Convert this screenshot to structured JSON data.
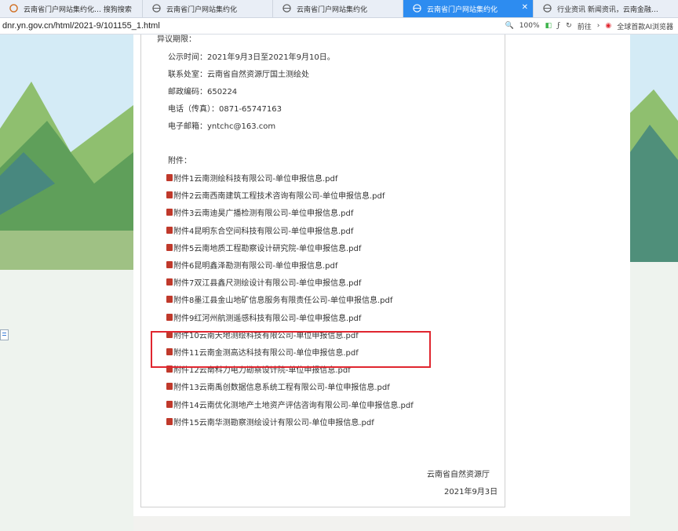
{
  "tabs": [
    {
      "label": "云南省门户网站集约化…  搜狗搜索",
      "active": false
    },
    {
      "label": "云南省门户网站集约化",
      "active": false
    },
    {
      "label": "云南省门户网站集约化",
      "active": false
    },
    {
      "label": "云南省门户网站集约化",
      "active": true
    },
    {
      "label": "行业资讯   新闻资讯，云南金融…",
      "active": false
    }
  ],
  "address_bar": {
    "url": "dnr.yn.gov.cn/html/2021-9/101155_1.html",
    "zoom": "100%",
    "extra_label": "前往",
    "right_label": "全球首款AI浏览器"
  },
  "document": {
    "intro_line": "异议期限：",
    "notice_period": "公示时间：2021年9月3日至2021年9月10日。",
    "contact_unit": "联系处室：云南省自然资源厅国土测绘处",
    "postcode": "邮政编码：650224",
    "phone": "电话（传真）：0871-65747163",
    "email": "电子邮箱：yntchc@163.com",
    "attachments_label": "附件：",
    "attachments": [
      "附件1云南测绘科技有限公司-单位申报信息.pdf",
      "附件2云南西南建筑工程技术咨询有限公司-单位申报信息.pdf",
      "附件3云南迪昊广播检测有限公司-单位申报信息.pdf",
      "附件4昆明东合空间科技有限公司-单位申报信息.pdf",
      "附件5云南地质工程勘察设计研究院-单位申报信息.pdf",
      "附件6昆明鑫泽勘测有限公司-单位申报信息.pdf",
      "附件7双江县鑫尺测绘设计有限公司-单位申报信息.pdf",
      "附件8墨江县金山地矿信息服务有限责任公司-单位申报信息.pdf",
      "附件9红河州航测遥感科技有限公司-单位申报信息.pdf",
      "附件10云南天地测绘科技有限公司-单位申报信息.pdf",
      "附件11云南金测高达科技有限公司-单位申报信息.pdf",
      "附件12云南科力电力勘察设计院-单位申报信息.pdf",
      "附件13云南禹创数据信息系统工程有限公司-单位申报信息.pdf",
      "附件14云南优化测地产土地资产评估咨询有限公司-单位申报信息.pdf",
      "附件15云南华测勘察测绘设计有限公司-单位申报信息.pdf"
    ],
    "signature_org": "云南省自然资源厅",
    "signature_date": "2021年9月3日"
  },
  "colors": {
    "highlight_box": "#e0262f",
    "active_tab": "#2d8cf0"
  }
}
